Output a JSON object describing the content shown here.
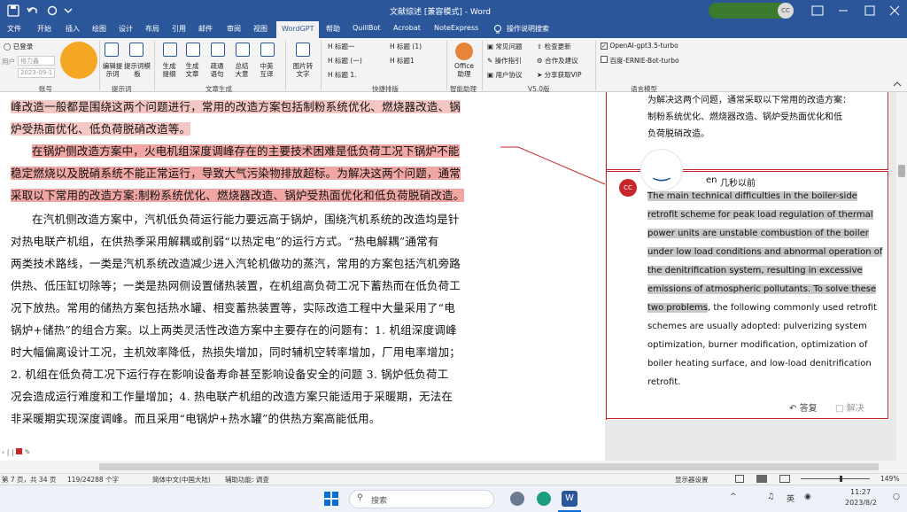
{
  "titlebar": {
    "file_name": "文献综述 [兼容模式]",
    "separator": "-",
    "app_name": "Word",
    "avatar_initials": "CC"
  },
  "menu": {
    "items": [
      "文件",
      "开始",
      "插入",
      "绘图",
      "设计",
      "布局",
      "引用",
      "邮件",
      "审阅",
      "视图",
      "WordGPT",
      "帮助",
      "QuillBot",
      "Acrobat",
      "NoteExpress",
      "操作说明搜索"
    ],
    "active": "WordGPT"
  },
  "ribbon": {
    "account": {
      "logged_in": "已登录",
      "user_label": "用户",
      "user_value": "格力鑫",
      "date_value": "2023-09-1",
      "group": "账号"
    },
    "prompts": {
      "btn1": "编辑提示词",
      "btn2": "提示词模板",
      "group": "提示词"
    },
    "gen_buttons": [
      "生成提纲",
      "生成文章",
      "疏通语句",
      "总结大意",
      "中英互译"
    ],
    "gen_group": "文章生成",
    "img_button": "图片转文字",
    "headings": [
      "标题一",
      "标题 (1)",
      "标题 (一)",
      "标题1",
      "标题 1."
    ],
    "format_group": "快捷排版",
    "office_btn": "Office助理",
    "smart_group": "智能助理",
    "version_items": [
      "常见问题",
      "检查更新",
      "操作指引",
      "合作及建议",
      "用户协议",
      "分享获取VIP"
    ],
    "version_group": "V5.0版",
    "models": [
      {
        "label": "OpenAI-gpt3.5-turbo",
        "checked": true
      },
      {
        "label": "百度-ERNIE-Bot-turbo",
        "checked": false
      }
    ],
    "models_group": "语言模型"
  },
  "document": {
    "lines": [
      "峰改造一般都是围绕这两个问题进行，常用的改造方案包括制粉系统优化、燃烧器改造、锅",
      "炉受热面优化、低负荷脱硝改造等。",
      "在锅炉侧改造方案中，火电机组深度调峰存在的主要技术困难是低负荷工况下锅炉不能",
      "稳定燃烧以及脱硝系统不能正常运行，导致大气污染物排放超标。为解决这两个问题，通常",
      "采取以下常用的改造方案:制粉系统优化、燃烧器改造、锅炉受热面优化和低负荷脱硝改造。",
      "在汽机侧改造方案中，汽机低负荷运行能力要远高于锅炉，围绕汽机系统的改造均是针",
      "对热电联产机组，在供热季采用解耦或削弱“以热定电”的运行方式。“热电解耦”通常有",
      "两类技术路线，一类是汽机系统改造减少进入汽轮机做功的蒸汽，常用的方案包括汽机旁路",
      "供热、低压缸切除等；一类是热网侧设置储热装置，在机组高负荷工况下蓄热而在低负荷工",
      "况下放热。常用的储热方案包括热水罐、相变蓄热装置等，实际改造工程中大量采用了“电",
      "锅炉+储热”的组合方案。以上两类灵活性改造方案中主要存在的问题有：1. 机组深度调峰",
      "时大幅偏离设计工况，主机效率降低，热损失增加，同时辅机空转率增加，厂用电率增加；",
      "2. 机组在低负荷工况下运行存在影响设备寿命甚至影响设备安全的问题 3. 锅炉低负荷工",
      "况会造成运行难度和工作量增加；4. 热电联产机组的改造方案只能适用于采暖期，无法在",
      "非采暖期实现深度调峰。而且采用“电锅炉+热水罐”的供热方案高能低用。"
    ]
  },
  "comments": {
    "prev_lines": [
      "为解决这两个问题，通常采取以下常用的改造方案：",
      "制粉系统优化、燃烧器改造、锅炉受热面优化和低",
      "负荷脱硝改造。"
    ],
    "author_initials": "CC",
    "author_suffix": "en",
    "time": "几秒以前",
    "body_lines": [
      "The main technical difficulties in the boiler-side",
      "retrofit scheme for peak load regulation of thermal",
      "power units are unstable combustion of the boiler",
      "under low load conditions and abnormal operation of",
      "the denitrification system, resulting in excessive",
      "emissions of atmospheric pollutants. To solve these",
      "two problems",
      ", the following commonly used retrofit",
      "schemes are usually adopted: pulverizing system",
      "optimization, burner modification, optimization of",
      "boiler heating surface, and low-load denitrification",
      "retrofit."
    ],
    "reply_label": "答复",
    "resolve_label": "解决"
  },
  "statusbar": {
    "page": "第 7 页，共 34 页",
    "words": "119/24288 个字",
    "language": "简体中文(中国大陆)",
    "accessibility": "辅助功能: 调查",
    "display_settings": "显示器设置",
    "zoom": "149%"
  },
  "taskbar": {
    "search_placeholder": "搜索",
    "ime": "英",
    "time": "11:27",
    "date": "2023/8/2"
  }
}
